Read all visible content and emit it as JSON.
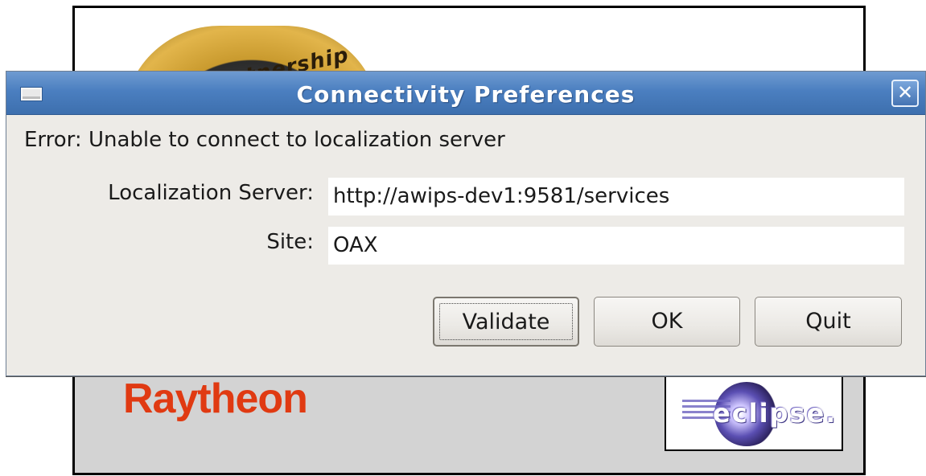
{
  "splash": {
    "seal_text": "Partnership • R",
    "raytheon_logo": "Raytheon",
    "eclipse_logo": "eclipse."
  },
  "dialog": {
    "title": "Connectivity Preferences",
    "window_menu_icon": "window-menu-icon",
    "close_symbol": "✕",
    "error_message": "Error: Unable to connect to localization server",
    "server_label": "Localization Server:",
    "server_value": "http://awips-dev1:9581/services",
    "site_label": "Site:",
    "site_value": "OAX",
    "buttons": {
      "validate": "Validate",
      "ok": "OK",
      "quit": "Quit"
    }
  },
  "colors": {
    "titlebar": "#4b7fc0",
    "dialog_bg": "#edebe7",
    "raytheon_red": "#e03a12"
  }
}
